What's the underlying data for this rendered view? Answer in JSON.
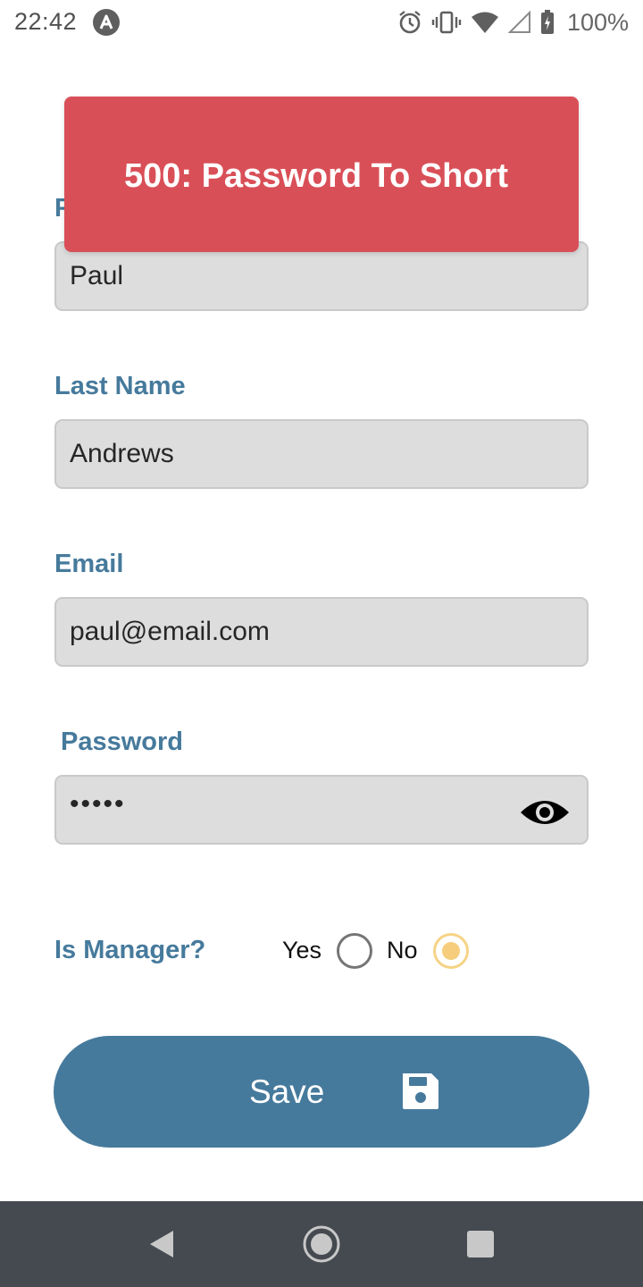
{
  "status_bar": {
    "time": "22:42",
    "battery": "100%",
    "icons": [
      "app-notification-icon",
      "alarm-icon",
      "vibrate-icon",
      "wifi-icon",
      "signal-icon",
      "battery-charging-icon"
    ]
  },
  "form": {
    "first_name": {
      "label": "F",
      "value": "Paul"
    },
    "last_name": {
      "label": "Last Name",
      "value": "Andrews"
    },
    "email": {
      "label": "Email",
      "value": "paul@email.com"
    },
    "password": {
      "label": "Password",
      "value": "•••••",
      "toggle_icon": "eye-icon"
    },
    "is_manager": {
      "label": "Is Manager?",
      "options": [
        "Yes",
        "No"
      ],
      "selected": "No"
    }
  },
  "toast": {
    "message": "500: Password To Short"
  },
  "save_button": {
    "label": "Save",
    "icon": "floppy-disk-icon"
  },
  "nav_bar": {
    "icons": [
      "back-icon",
      "home-icon",
      "recents-icon"
    ]
  },
  "colors": {
    "accent": "#467a9c",
    "error": "#d94f57",
    "field_bg": "#dddddd",
    "radio_selected": "#f5cd7c",
    "nav_bg": "#444a50"
  }
}
